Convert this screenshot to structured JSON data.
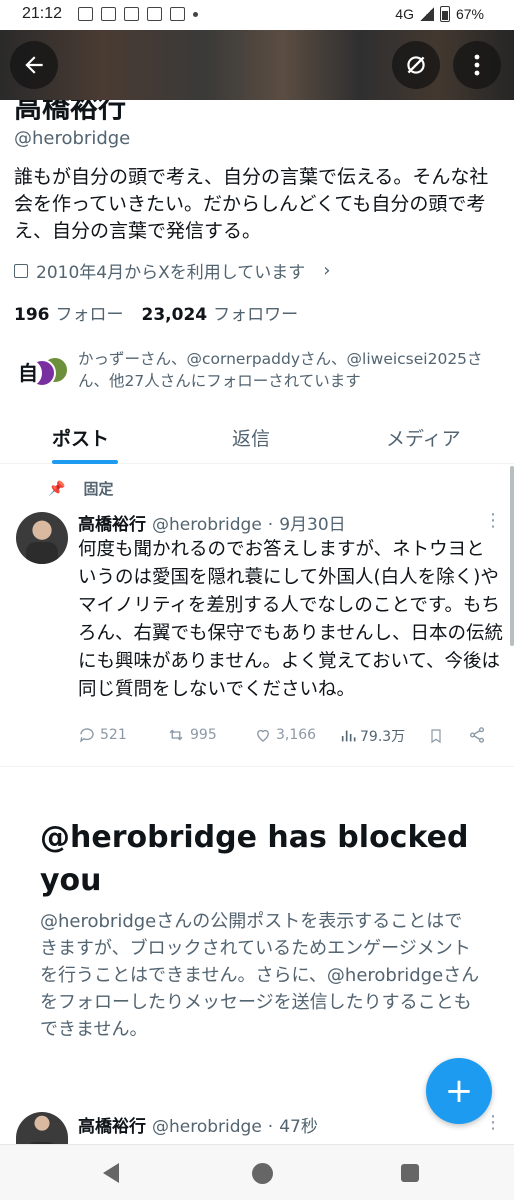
{
  "status_bar": {
    "time": "21:12",
    "network": "4G",
    "battery": "67%"
  },
  "profile": {
    "display_name": "高橋裕行",
    "handle": "@herobridge",
    "bio": "誰もが自分の頭で考え、自分の言葉で伝える。そんな社会を作っていきたい。だからしんどくても自分の頭で考え、自分の言葉で発信する。",
    "joined": "2010年4月からXを利用しています",
    "following_count": "196",
    "following_label": "フォロー",
    "followers_count": "23,024",
    "followers_label": "フォロワー",
    "followed_by": "かっずーさん、@cornerpaddyさん、@liweicsei2025さん、他27人さんにフォローされています",
    "follower_avatar_char": "自"
  },
  "tabs": [
    {
      "label": "ポスト",
      "active": true
    },
    {
      "label": "返信",
      "active": false
    },
    {
      "label": "メディア",
      "active": false
    }
  ],
  "pinned_post": {
    "pinned_label": "固定",
    "display_name": "高橋裕行",
    "handle": "@herobridge",
    "time": "9月30日",
    "body": "何度も聞かれるのでお答えしますが、ネトウヨというのは愛国を隠れ蓑にして外国人(白人を除く)やマイノリティを差別する人でなしのことです。もちろん、右翼でも保守でもありませんし、日本の伝統にも興味がありません。よく覚えておいて、今後は同じ質問をしないでくださいね。",
    "replies": "521",
    "reposts": "995",
    "likes": "3,166",
    "views": "79.3万"
  },
  "block_notice": {
    "title": "@herobridge has blocked you",
    "description": "@herobridgeさんの公開ポストを表示することはできますが、ブロックされているためエンゲージメントを行うことはできません。さらに、@herobridgeさんをフォローしたりメッセージを送信したりすることもできません。"
  },
  "second_post": {
    "display_name": "高橋裕行",
    "handle": "@herobridge",
    "time": "47秒"
  },
  "fab_label": "+",
  "colors": {
    "accent": "#1d9bf0",
    "secondary_text": "#536471"
  },
  "icons": [
    "back-arrow-icon",
    "grok-icon",
    "more-icon",
    "calendar-icon",
    "chevron-right-icon",
    "pin-icon",
    "reply-icon",
    "repost-icon",
    "like-icon",
    "views-icon",
    "bookmark-icon",
    "share-icon",
    "compose-icon"
  ]
}
